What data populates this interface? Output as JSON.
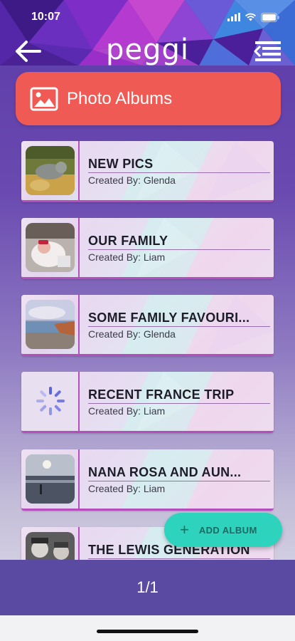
{
  "status_bar": {
    "time": "10:07"
  },
  "header": {
    "logo": "peggi"
  },
  "page_title": {
    "label": "Photo Albums",
    "icon": "image-icon"
  },
  "albums": [
    {
      "name": "NEW PICS",
      "created_by": "Created By: Glenda",
      "thumb": "cat-photo"
    },
    {
      "name": "OUR FAMILY",
      "created_by": "Created By: Liam",
      "thumb": "baby-photo"
    },
    {
      "name": "SOME FAMILY FAVOURI...",
      "created_by": "Created By: Glenda",
      "thumb": "beach-photo"
    },
    {
      "name": "RECENT FRANCE TRIP",
      "created_by": "Created By: Liam",
      "thumb": "loading-spinner"
    },
    {
      "name": "NANA ROSA AND AUN...",
      "created_by": "Created By: Liam",
      "thumb": "sunset-beach-photo"
    },
    {
      "name": "THE LEWIS GENERATION",
      "created_by": "",
      "thumb": "children-photo"
    }
  ],
  "fab": {
    "label": "ADD ALBUM",
    "icon": "plus-icon"
  },
  "pager": {
    "text": "1/1"
  },
  "colors": {
    "accent_red": "#ef5a54",
    "fab_teal": "#2ed3bd",
    "pager_bar": "#5a4aa2",
    "album_border": "#b64dbd"
  }
}
